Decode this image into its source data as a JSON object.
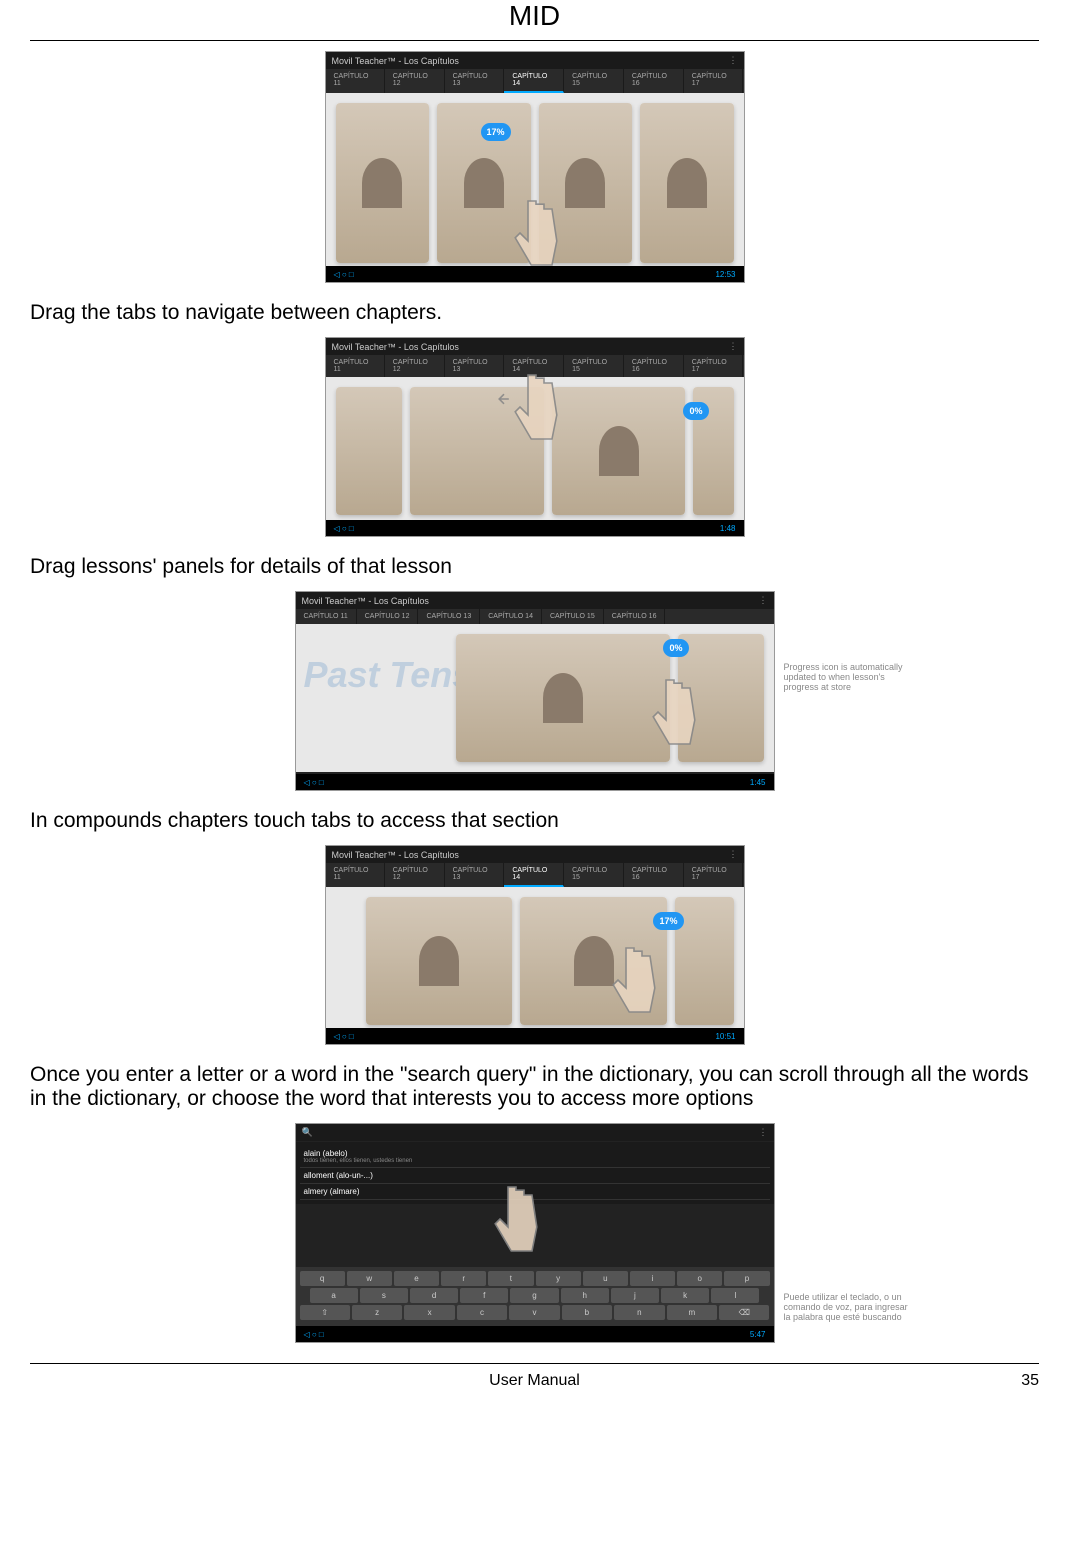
{
  "header": {
    "title": "MID"
  },
  "instructions": {
    "i1": "Drag the tabs to navigate between chapters.",
    "i2": "Drag lessons' panels for details of that lesson",
    "i3": "In compounds chapters touch tabs to access that section",
    "i4": "Once you enter a letter or a word in the \"search query\" in the dictionary, you can scroll through all the words in the dictionary, or choose the word that interests you to access more options"
  },
  "app": {
    "title": "Movil Teacher™ - Los Capítulos",
    "tabs": [
      "CAPÍTULO 11",
      "CAPÍTULO 12",
      "CAPÍTULO 13",
      "CAPÍTULO 14",
      "CAPÍTULO 15",
      "CAPÍTULO 16",
      "CAPÍTULO 17"
    ],
    "progress1": "17%",
    "progress2": "0%",
    "progress3": "0%",
    "progress4": "17%",
    "clock1": "12:53",
    "clock2": "1:48",
    "clock3": "1:45",
    "clock4": "10:51",
    "clock5": "5:47"
  },
  "hints": {
    "h3": "Progress icon is automatically updated to when lesson's progress at store",
    "h5": "Puede utilizar el teclado, o un comando de voz, para ingresar la palabra que esté buscando"
  },
  "dictionary": {
    "item1": "alain (abelo)",
    "item1_sub": "todos tienen, ellos tienen, ustedes tienen",
    "item2": "alloment (alo-un-...)",
    "item3": "almery (almare)"
  },
  "keyboard": {
    "row1": [
      "q",
      "w",
      "e",
      "r",
      "t",
      "y",
      "u",
      "i",
      "o",
      "p"
    ],
    "row2": [
      "a",
      "s",
      "d",
      "f",
      "g",
      "h",
      "j",
      "k",
      "l"
    ],
    "row3": [
      "⇧",
      "z",
      "x",
      "c",
      "v",
      "b",
      "n",
      "m",
      "⌫"
    ]
  },
  "decorative": {
    "past_tense": "Past Tense"
  },
  "footer": {
    "label": "User Manual",
    "page": "35"
  }
}
